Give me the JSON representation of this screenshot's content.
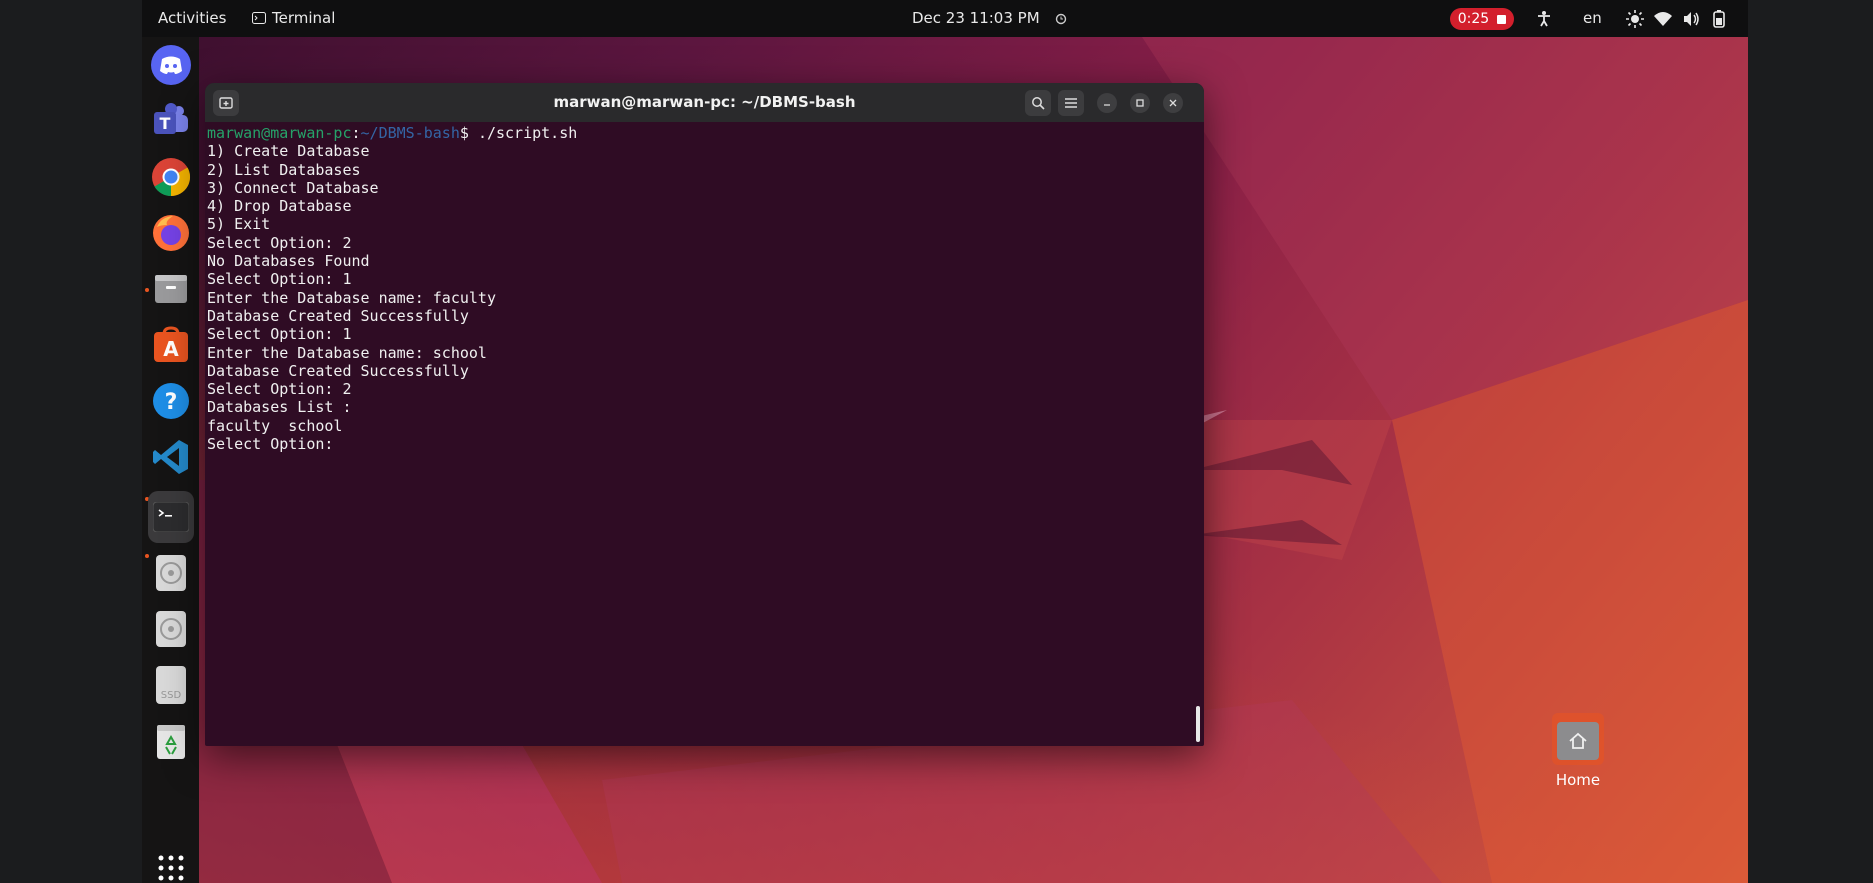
{
  "topbar": {
    "activities": "Activities",
    "app_menu": "Terminal",
    "clock": "Dec 23  11:03 PM",
    "recording": "0:25",
    "lang": "en"
  },
  "dock": {
    "apps": [
      "Discord",
      "Microsoft Teams",
      "Google Chrome",
      "Firefox",
      "Files",
      "Ubuntu Software",
      "Help",
      "Visual Studio Code",
      "Terminal",
      "Disc 1",
      "Disc 2",
      "SSD",
      "Trash"
    ],
    "ssd_label": "SSD"
  },
  "terminal": {
    "title": "marwan@marwan-pc: ~/DBMS-bash",
    "prompt_user": "marwan@marwan-pc",
    "prompt_sep": ":",
    "prompt_path": "~/DBMS-bash",
    "prompt_dollar": "$ ",
    "command": "./script.sh",
    "lines": [
      "1) Create Database",
      "2) List Databases",
      "3) Connect Database",
      "4) Drop Database",
      "5) Exit",
      "Select Option: 2",
      "No Databases Found",
      "Select Option: 1",
      "Enter the Database name: faculty",
      "Database Created Successfully",
      "Select Option: 1",
      "Enter the Database name: school",
      "Database Created Successfully",
      "Select Option: 2",
      "Databases List :",
      "faculty  school",
      "Select Option: "
    ]
  },
  "desktop": {
    "home_label": "Home"
  },
  "colors": {
    "ubuntu_orange": "#e95420",
    "terminal_bg": "#2f0c24",
    "prompt_user": "#26a269",
    "prompt_path": "#3465a4",
    "recording_red": "#d31f2c"
  }
}
